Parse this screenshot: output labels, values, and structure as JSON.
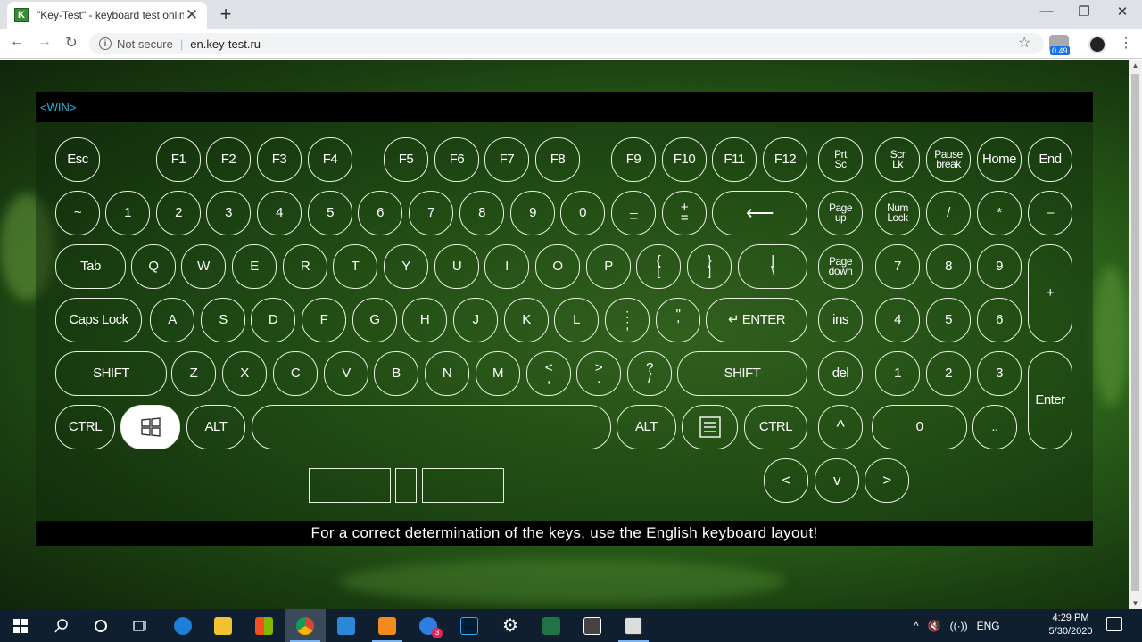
{
  "browser": {
    "tab_favicon": "K",
    "tab_title": "\"Key-Test\" - keyboard test online",
    "tab_close": "✕",
    "new_tab": "+",
    "minimize": "—",
    "maximize": "❐",
    "close": "✕",
    "back": "←",
    "forward": "→",
    "reload": "↻",
    "info_icon": "i",
    "not_secure": "Not secure",
    "separator": "|",
    "url": "en.key-test.ru",
    "star": "☆",
    "extension_badge": "0.49",
    "menu": "⋮"
  },
  "page": {
    "key_indicator": "<WIN>",
    "footer_text": "For a correct determination of the keys, use the English keyboard layout!"
  },
  "keys": {
    "esc": "Esc",
    "f1": "F1",
    "f2": "F2",
    "f3": "F3",
    "f4": "F4",
    "f5": "F5",
    "f6": "F6",
    "f7": "F7",
    "f8": "F8",
    "f9": "F9",
    "f10": "F10",
    "f11": "F11",
    "f12": "F12",
    "prtsc_top": "Prt",
    "prtsc_bottom": "Sc",
    "scrlk_top": "Scr",
    "scrlk_bottom": "Lk",
    "pause_top": "Pause",
    "pause_bottom": "break",
    "home": "Home",
    "end": "End",
    "tilde": "~",
    "d1": "1",
    "d2": "2",
    "d3": "3",
    "d4": "4",
    "d5": "5",
    "d6": "6",
    "d7": "7",
    "d8": "8",
    "d9": "9",
    "d0": "0",
    "minus_top": "_",
    "minus_bottom": "–",
    "plus_top": "+",
    "plus_bottom": "=",
    "backspace": "⟵",
    "pgup_top": "Page",
    "pgup_bottom": "up",
    "numlock_top": "Num",
    "numlock_bottom": "Lock",
    "np_div": "/",
    "np_mul": "*",
    "np_sub": "–",
    "tab": "Tab",
    "q": "Q",
    "w": "W",
    "e": "E",
    "r": "R",
    "t": "T",
    "y": "Y",
    "u": "U",
    "i": "I",
    "o": "O",
    "p": "P",
    "lbr_top": "{",
    "lbr_bottom": "[",
    "rbr_top": "}",
    "rbr_bottom": "]",
    "bslash_top": "|",
    "bslash_bottom": "\\",
    "pgdn_top": "Page",
    "pgdn_bottom": "down",
    "np7": "7",
    "np8": "8",
    "np9": "9",
    "np_add": "+",
    "caps": "Caps Lock",
    "a": "A",
    "s": "S",
    "d": "D",
    "f": "F",
    "g": "G",
    "h": "H",
    "j": "J",
    "k": "K",
    "l": "L",
    "semi_top": ":",
    "semi_bottom": ";",
    "quote_top": "\"",
    "quote_bottom": "'",
    "enter": "↵ ENTER",
    "ins": "ins",
    "np4": "4",
    "np5": "5",
    "np6": "6",
    "lshift": "SHIFT",
    "z": "Z",
    "x": "X",
    "c": "C",
    "v": "V",
    "b": "B",
    "n": "N",
    "m": "M",
    "comma_top": "<",
    "comma_bottom": ",",
    "period_top": ">",
    "period_bottom": ".",
    "slash_top": "?",
    "slash_bottom": "/",
    "rshift": "SHIFT",
    "del": "del",
    "np1": "1",
    "np2": "2",
    "np3": "3",
    "np_enter": "Enter",
    "lctrl": "CTRL",
    "lalt": "ALT",
    "ralt": "ALT",
    "rctrl": "CTRL",
    "up": "^",
    "np0": "0",
    "np_dot": ".,",
    "left": "<",
    "down": "v",
    "right": ">"
  },
  "taskbar": {
    "tray_caret": "^",
    "tray_volume": "🔇",
    "tray_wifi": "((·))",
    "language": "ENG",
    "time": "4:29 PM",
    "date": "5/30/2020",
    "notifications_count": "3"
  },
  "colors": {
    "key_border": "#e8f0e0",
    "indicator_text": "#2ab0d4",
    "active_key_bg": "#ffffff"
  }
}
